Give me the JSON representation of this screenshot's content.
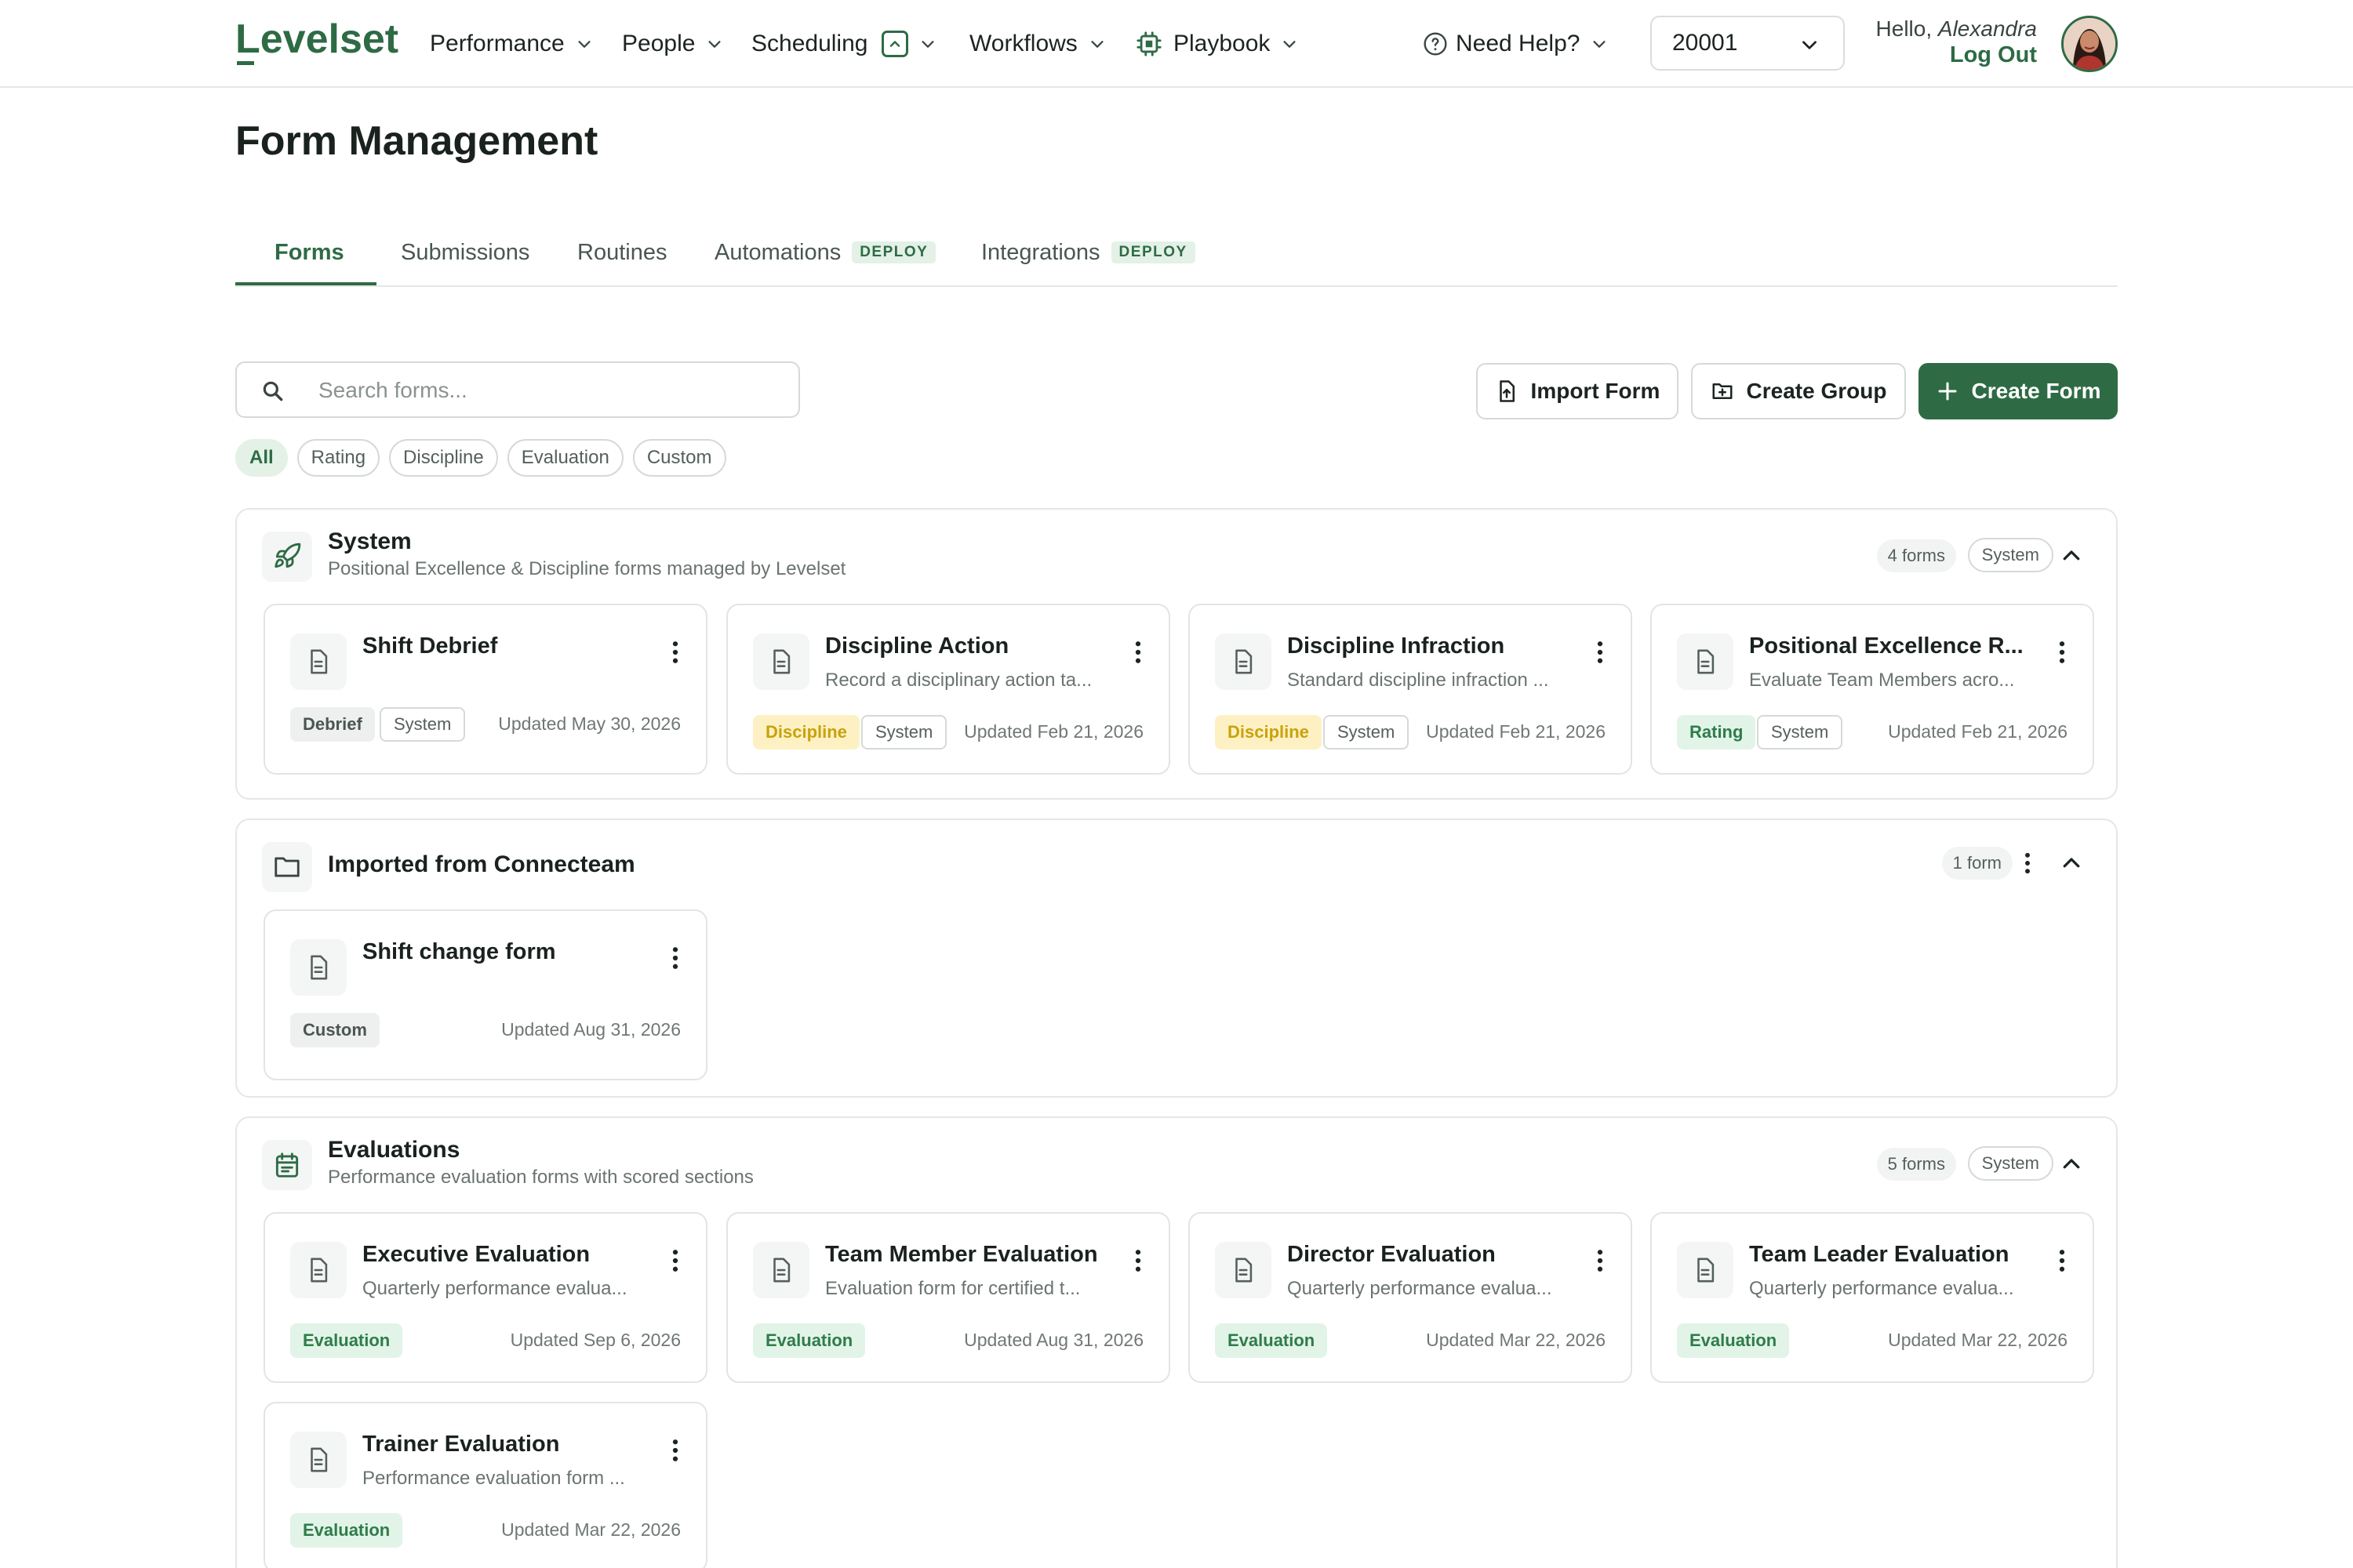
{
  "nav": {
    "logo": "Levelset",
    "items": [
      {
        "label": "Performance"
      },
      {
        "label": "People"
      },
      {
        "label": "Scheduling"
      },
      {
        "label": "Workflows"
      },
      {
        "label": "Playbook"
      }
    ],
    "help": "Need Help?",
    "store": "20001",
    "hello": "Hello,",
    "user": "Alexandra",
    "logout": "Log Out"
  },
  "page": {
    "title": "Form Management",
    "tabs": [
      {
        "label": "Forms",
        "active": true
      },
      {
        "label": "Submissions"
      },
      {
        "label": "Routines"
      },
      {
        "label": "Automations",
        "badge": "DEPLOY"
      },
      {
        "label": "Integrations",
        "badge": "DEPLOY"
      }
    ]
  },
  "toolbar": {
    "search_placeholder": "Search forms...",
    "import": "Import Form",
    "create_group": "Create Group",
    "create_form": "Create Form",
    "filters": [
      "All",
      "Rating",
      "Discipline",
      "Evaluation",
      "Custom"
    ]
  },
  "colors": {
    "brand": "#2e6b45",
    "discipline_tag": "#fdf1c4",
    "evaluation_tag": "#e2f4e8"
  },
  "groups": [
    {
      "title": "System",
      "subtitle": "Positional Excellence & Discipline forms managed by Levelset",
      "count": "4 forms",
      "pill": "System",
      "icon": "rocket-icon",
      "forms": [
        {
          "title": "Shift Debrief",
          "desc": "",
          "tag": "Debrief",
          "system": "System",
          "updated": "Updated May 30, 2026"
        },
        {
          "title": "Discipline Action",
          "desc": "Record a disciplinary action ta...",
          "tag": "Discipline",
          "system": "System",
          "updated": "Updated Feb 21, 2026"
        },
        {
          "title": "Discipline Infraction",
          "desc": "Standard discipline infraction ...",
          "tag": "Discipline",
          "system": "System",
          "updated": "Updated Feb 21, 2026"
        },
        {
          "title": "Positional Excellence R...",
          "desc": "Evaluate Team Members acro...",
          "tag": "Rating",
          "system": "System",
          "updated": "Updated Feb 21, 2026"
        }
      ]
    },
    {
      "title": "Imported from Connecteam",
      "count": "1 form",
      "icon": "folder-icon",
      "forms": [
        {
          "title": "Shift change form",
          "desc": "",
          "tag": "Custom",
          "updated": "Updated Aug 31, 2026"
        }
      ]
    },
    {
      "title": "Evaluations",
      "subtitle": "Performance evaluation forms with scored sections",
      "count": "5 forms",
      "pill": "System",
      "icon": "calendar-icon",
      "forms": [
        {
          "title": "Executive Evaluation",
          "desc": "Quarterly performance evalua...",
          "tag": "Evaluation",
          "updated": "Updated Sep 6, 2026"
        },
        {
          "title": "Team Member Evaluation",
          "desc": "Evaluation form for certified t...",
          "tag": "Evaluation",
          "updated": "Updated Aug 31, 2026"
        },
        {
          "title": "Director Evaluation",
          "desc": "Quarterly performance evalua...",
          "tag": "Evaluation",
          "updated": "Updated Mar 22, 2026"
        },
        {
          "title": "Team Leader Evaluation",
          "desc": "Quarterly performance evalua...",
          "tag": "Evaluation",
          "updated": "Updated Mar 22, 2026"
        },
        {
          "title": "Trainer Evaluation",
          "desc": "Performance evaluation form ...",
          "tag": "Evaluation",
          "updated": "Updated Mar 22, 2026"
        }
      ]
    }
  ]
}
